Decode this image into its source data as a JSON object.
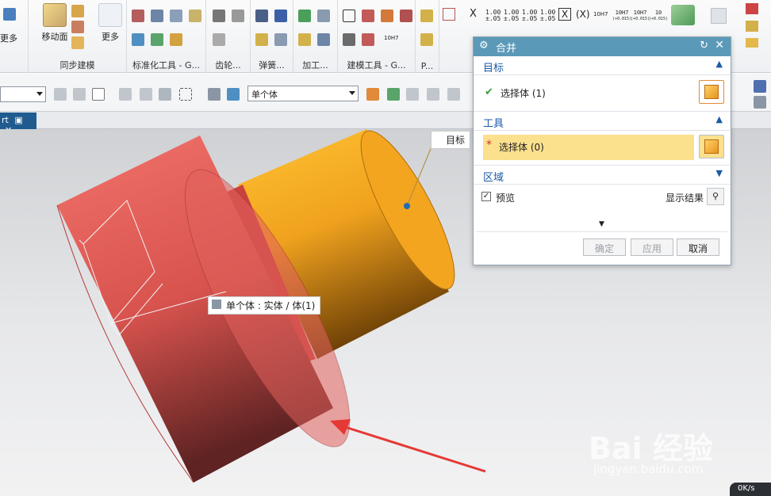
{
  "ribbon": {
    "more_left": "更多",
    "move_face": "移动面",
    "more": "更多",
    "groups": [
      "同步建模",
      "标准化工具 - G...",
      "齿轮...",
      "弹簧...",
      "加工...",
      "建模工具 - G...",
      "P..."
    ],
    "dims": [
      {
        "top": "1.00",
        "bot": "±.05"
      },
      {
        "top": "1.00",
        "bot": "±.05"
      },
      {
        "top": "1.00",
        "bot": "±.05"
      },
      {
        "top": "1.00",
        "bot": "±.05"
      }
    ],
    "x_box": "X",
    "x_paren": "(X)",
    "fit1": "10H7",
    "fit2": {
      "top": "10H7",
      "bot": "(+0.015)"
    },
    "fit3": {
      "top": "10H7",
      "bot": "(+0.015)"
    },
    "fit4": {
      "top": "10",
      "bot": "(+0.015)"
    }
  },
  "toolbar2": {
    "filter_value": "单个体"
  },
  "tab": {
    "label": "rt"
  },
  "viewport": {
    "target_tag": "目标",
    "body_tip": "单个体 : 实体 / 体(1)",
    "watermark": "Bai 经验",
    "watermark_url": "jingyan.baidu.com",
    "corner": "0K/s"
  },
  "dialog": {
    "title": "合并",
    "target_header": "目标",
    "target_select": "选择体 (1)",
    "tool_header": "工具",
    "tool_select": "选择体 (0)",
    "region_header": "区域",
    "preview": "预览",
    "show_result": "显示结果",
    "ok": "确定",
    "apply": "应用",
    "cancel": "取消"
  },
  "colors": {
    "title_bar": "#5b99b8",
    "section_text": "#1c5aa8",
    "tool_highlight": "#fbe08e",
    "cyl_red": "#e85f59",
    "cyl_orange": "#f5a623"
  }
}
